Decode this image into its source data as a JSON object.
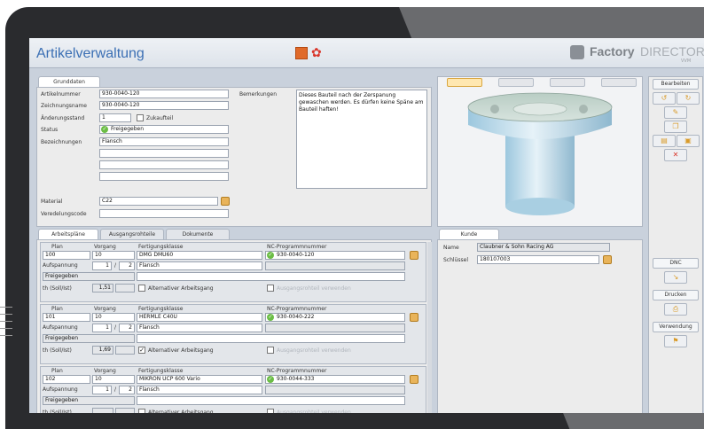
{
  "app": {
    "title": "Artikelverwaltung"
  },
  "brand": {
    "strong": "Factory",
    "light": "DIRECTOR",
    "sub": "VVM"
  },
  "grunddaten": {
    "tab": "Grunddaten",
    "labels": {
      "artikelnummer": "Artikelnummer",
      "zeichnungsname": "Zeichnungsname",
      "aenderungsstand": "Änderungsstand",
      "status": "Status",
      "bezeichnungen": "Bezeichnungen",
      "material": "Material",
      "veredelungscode": "Veredelungscode",
      "bemerkungen": "Bemerkungen"
    },
    "artikelnummer": "930-0040-120",
    "zeichnungsname": "930-0040-120",
    "aenderungsstand": "1",
    "zukaufteil_label": "Zukaufteil",
    "status": "Freigegeben",
    "bezeichnung_1": "Flansch",
    "material": "C22",
    "bemerkungen": "Dieses Bauteil nach der Zerspanung gewaschen werden. Es dürfen keine Späne am Bauteil haften!"
  },
  "lower_tabs": [
    "Arbeitspläne",
    "Ausgangsrohteile",
    "Dokumente"
  ],
  "plan_headers": {
    "plan": "Plan",
    "vorgang": "Vorgang",
    "fertigungsklasse": "Fertigungsklasse",
    "nc": "NC-Programmnummer",
    "aufspannung": "Aufspannung",
    "th": "th (Soll/Ist)",
    "alternativ": "Alternativer Arbeitsgang",
    "ausgangsrohteil": "Ausgangsrohteil verwenden"
  },
  "plans": [
    {
      "plan": "100",
      "vorgang": "10",
      "klasse": "DMG DMU60",
      "nc": "930-0040-120",
      "aufspannung": "1",
      "von": "2",
      "bezeichnung": "Flansch",
      "status": "Freigegeben",
      "th": "1,51",
      "alt_checked": "",
      "alt_mark": ""
    },
    {
      "plan": "101",
      "vorgang": "10",
      "klasse": "HERMLE C40U",
      "nc": "930-0040-222",
      "aufspannung": "1",
      "von": "2",
      "bezeichnung": "Flansch",
      "status": "Freigegeben",
      "th": "1,69",
      "alt_checked": "✓",
      "alt_mark": ""
    },
    {
      "plan": "102",
      "vorgang": "10",
      "klasse": "MIKRON UCP 600 Vario",
      "nc": "930-0044-333",
      "aufspannung": "1",
      "von": "2",
      "bezeichnung": "Flansch",
      "status": "Freigegeben",
      "th": "",
      "alt_checked": "",
      "alt_mark": ""
    }
  ],
  "kunde": {
    "tab": "Kunde",
    "name_label": "Name",
    "name": "Claubner & Sohn Racing AG",
    "schluessel_label": "Schlüssel",
    "schluessel": "180107003"
  },
  "sidebar": {
    "bearbeiten": "Bearbeiten",
    "dnc": "DNC",
    "drucken": "Drucken",
    "verwendung": "Verwendung"
  },
  "colors": {
    "accent": "#3b6fb4",
    "ok": "#6bbd45",
    "delete": "#d9362b"
  }
}
